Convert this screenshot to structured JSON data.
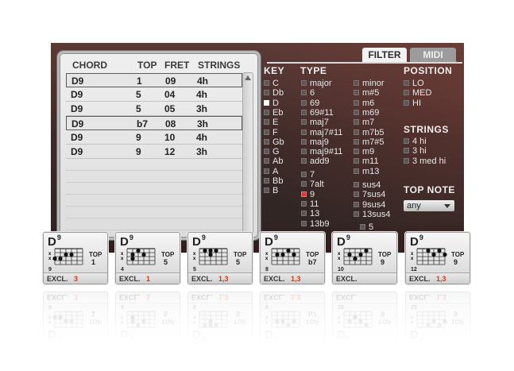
{
  "chord_list": {
    "headers": {
      "chord": "CHORD",
      "top": "TOP",
      "fret": "FRET",
      "strings": "STRINGS"
    },
    "rows": [
      {
        "chord": "D9",
        "top": "1",
        "fret": "09",
        "strings": "4h",
        "selected": true
      },
      {
        "chord": "D9",
        "top": "5",
        "fret": "04",
        "strings": "4h",
        "selected": false
      },
      {
        "chord": "D9",
        "top": "5",
        "fret": "05",
        "strings": "3h",
        "selected": false
      },
      {
        "chord": "D9",
        "top": "b7",
        "fret": "08",
        "strings": "3h",
        "selected": true
      },
      {
        "chord": "D9",
        "top": "9",
        "fret": "10",
        "strings": "4h",
        "selected": false
      },
      {
        "chord": "D9",
        "top": "9",
        "fret": "12",
        "strings": "3h",
        "selected": false
      }
    ]
  },
  "tabs": {
    "filter": "FILTER",
    "midi": "MIDI",
    "active": "FILTER"
  },
  "filter": {
    "key": {
      "title": "KEY",
      "items": [
        {
          "label": "C",
          "state": "off"
        },
        {
          "label": "Db",
          "state": "off"
        },
        {
          "label": "D",
          "state": "on"
        },
        {
          "label": "Eb",
          "state": "off"
        },
        {
          "label": "E",
          "state": "off"
        },
        {
          "label": "F",
          "state": "off"
        },
        {
          "label": "Gb",
          "state": "off"
        },
        {
          "label": "G",
          "state": "off"
        },
        {
          "label": "Ab",
          "state": "off"
        },
        {
          "label": "A",
          "state": "off"
        },
        {
          "label": "Bb",
          "state": "off"
        },
        {
          "label": "B",
          "state": "off"
        }
      ]
    },
    "type": {
      "title": "TYPE",
      "col1": [
        {
          "label": "major",
          "state": "off"
        },
        {
          "label": "6",
          "state": "off"
        },
        {
          "label": "69",
          "state": "off"
        },
        {
          "label": "69#11",
          "state": "off"
        },
        {
          "label": "maj7",
          "state": "off"
        },
        {
          "label": "maj7#11",
          "state": "off"
        },
        {
          "label": "maj9",
          "state": "off"
        },
        {
          "label": "maj9#11",
          "state": "off"
        },
        {
          "label": "add9",
          "state": "off"
        }
      ],
      "col1b": [
        {
          "label": "7",
          "state": "off"
        },
        {
          "label": "7alt",
          "state": "off"
        },
        {
          "label": "9",
          "state": "red"
        },
        {
          "label": "11",
          "state": "off"
        },
        {
          "label": "13",
          "state": "off"
        },
        {
          "label": "13b9",
          "state": "off"
        }
      ],
      "col2": [
        {
          "label": "minor",
          "state": "off"
        },
        {
          "label": "m#5",
          "state": "off"
        },
        {
          "label": "m6",
          "state": "off"
        },
        {
          "label": "m69",
          "state": "off"
        },
        {
          "label": "m7",
          "state": "off"
        },
        {
          "label": "m7b5",
          "state": "off"
        },
        {
          "label": "m7#5",
          "state": "off"
        },
        {
          "label": "m9",
          "state": "off"
        },
        {
          "label": "m11",
          "state": "off"
        },
        {
          "label": "m13",
          "state": "off"
        }
      ],
      "col2b": [
        {
          "label": "sus4",
          "state": "off"
        },
        {
          "label": "7sus4",
          "state": "off"
        },
        {
          "label": "9sus4",
          "state": "off"
        },
        {
          "label": "13sus4",
          "state": "off"
        }
      ],
      "extra": "5"
    },
    "position": {
      "title": "POSITION",
      "items": [
        {
          "label": "LO",
          "state": "off"
        },
        {
          "label": "MED",
          "state": "off"
        },
        {
          "label": "HI",
          "state": "off"
        }
      ]
    },
    "strings": {
      "title": "STRINGS",
      "items": [
        {
          "label": "4 hi",
          "state": "off"
        },
        {
          "label": "3 hi",
          "state": "off"
        },
        {
          "label": "3 med hi",
          "state": "off"
        }
      ]
    },
    "top_note": {
      "title": "TOP NOTE",
      "value": "any"
    }
  },
  "cards": [
    {
      "name": "D",
      "sup": "9",
      "top_label": "TOP",
      "top": "1",
      "fret": "9",
      "excl_label": "EXCL.",
      "excl": "3",
      "dots": [
        [
          2,
          0
        ],
        [
          2,
          1
        ],
        [
          1,
          2
        ],
        [
          1,
          3
        ]
      ]
    },
    {
      "name": "D",
      "sup": "9",
      "top_label": "TOP",
      "top": "5",
      "fret": "4",
      "excl_label": "EXCL.",
      "excl": "1",
      "dots": [
        [
          1,
          1
        ],
        [
          2,
          1
        ],
        [
          0,
          2
        ],
        [
          1,
          3
        ]
      ]
    },
    {
      "name": "D",
      "sup": "9",
      "top_label": "TOP",
      "top": "5",
      "fret": "5",
      "excl_label": "EXCL.",
      "excl": "1,3",
      "dots": [
        [
          0,
          1
        ],
        [
          0,
          2
        ],
        [
          1,
          2
        ],
        [
          0,
          3
        ]
      ]
    },
    {
      "name": "D",
      "sup": "9",
      "top_label": "TOP",
      "top": "b7",
      "fret": "8",
      "excl_label": "EXCL.",
      "excl": "1,3",
      "dots": [
        [
          1,
          1
        ],
        [
          1,
          2
        ],
        [
          0,
          3
        ],
        [
          1,
          4
        ]
      ]
    },
    {
      "name": "D",
      "sup": "9",
      "top_label": "TOP",
      "top": "9",
      "fret": "10",
      "excl_label": "EXCL.",
      "excl": "",
      "dots": [
        [
          1,
          1
        ],
        [
          2,
          2
        ],
        [
          1,
          3
        ],
        [
          0,
          4
        ]
      ]
    },
    {
      "name": "D",
      "sup": "9",
      "top_label": "TOP",
      "top": "9",
      "fret": "12",
      "excl_label": "EXCL.",
      "excl": "1,3",
      "dots": [
        [
          0,
          2
        ],
        [
          1,
          3
        ],
        [
          0,
          4
        ],
        [
          1,
          5
        ]
      ]
    }
  ]
}
